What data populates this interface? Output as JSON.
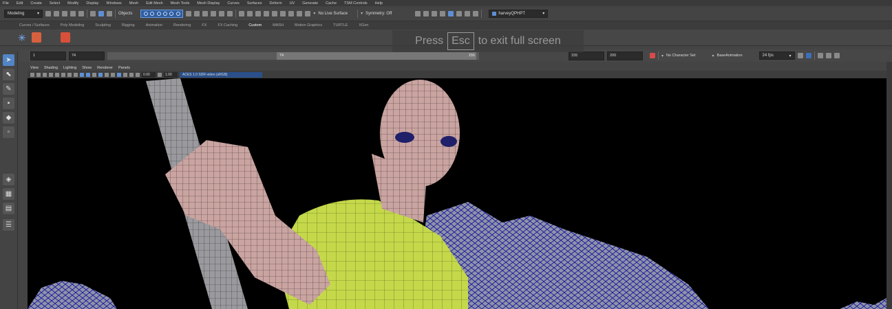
{
  "menubar": {
    "items": [
      "File",
      "Edit",
      "Create",
      "Select",
      "Modify",
      "Display",
      "Windows",
      "Mesh",
      "Edit Mesh",
      "Mesh Tools",
      "Mesh Display",
      "Curves",
      "Surfaces",
      "Deform",
      "UV",
      "Generate",
      "Cache",
      "TSM Controls",
      "Help"
    ]
  },
  "statusline": {
    "menuset": "Modeling",
    "objects_label": "Objects",
    "live_surface": "No Live Surface",
    "symmetry": "Symmetry: Off",
    "workspace": "harveyQPHPT"
  },
  "shelf": {
    "tabs": [
      "Curves / Surfaces",
      "Poly Modeling",
      "Sculpting",
      "Rigging",
      "Animation",
      "Rendering",
      "FX",
      "FX Caching",
      "Custom",
      "MASH",
      "Motion Graphics",
      "TURTLE",
      "XGen"
    ],
    "active_tab": "Custom"
  },
  "fullscreen_hint": {
    "prefix": "Press",
    "key": "Esc",
    "suffix": "to exit full screen"
  },
  "timeslider": {
    "start": "1",
    "playback_start": "74",
    "range_start_label": "74",
    "range_end_label": "155",
    "playback_end": "155",
    "end": "200",
    "character_set": "No Character Set",
    "anim_layer": "BaseAnimation",
    "fps": "24 fps"
  },
  "panel": {
    "menus": [
      "View",
      "Shading",
      "Lighting",
      "Show",
      "Renderer",
      "Panels"
    ],
    "exposure": "0.00",
    "gamma": "1.00",
    "color_space": "ACES 1.0 SDR-video (sRGB)"
  },
  "colors": {
    "accent": "#5285c6",
    "shirt": "#c8d94a",
    "skin": "#c9a7a0",
    "wire": "#2222aa"
  }
}
